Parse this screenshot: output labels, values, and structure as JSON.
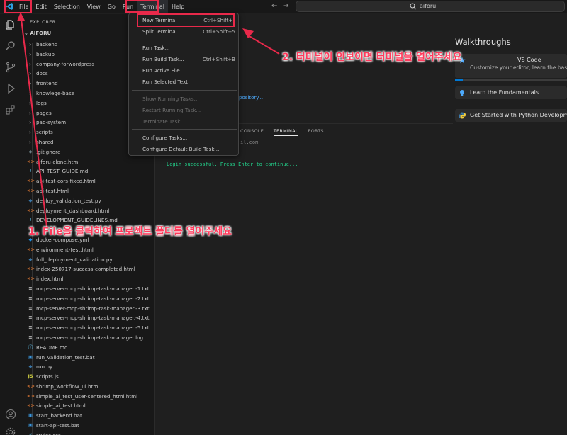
{
  "titlebar": {
    "menus": [
      "File",
      "Edit",
      "Selection",
      "View",
      "Go",
      "Run",
      "Terminal",
      "Help"
    ],
    "active_menu": "Terminal",
    "search_text": "aiforu"
  },
  "sidebar": {
    "title": "EXPLORER",
    "root": "AIFORU",
    "items": [
      {
        "label": "backend",
        "type": "folder"
      },
      {
        "label": "backup",
        "type": "folder"
      },
      {
        "label": "company-forwordpress",
        "type": "folder"
      },
      {
        "label": "docs",
        "type": "folder"
      },
      {
        "label": "frontend",
        "type": "folder"
      },
      {
        "label": "knowlege-base",
        "type": "folder"
      },
      {
        "label": "logs",
        "type": "folder"
      },
      {
        "label": "pages",
        "type": "folder"
      },
      {
        "label": "pad-system",
        "type": "folder"
      },
      {
        "label": "scripts",
        "type": "folder"
      },
      {
        "label": "shared",
        "type": "folder"
      },
      {
        "label": ".gitignore",
        "type": "git"
      },
      {
        "label": "aiforu-clone.html",
        "type": "html"
      },
      {
        "label": "API_TEST_GUIDE.md",
        "type": "md"
      },
      {
        "label": "api-test-cors-fixed.html",
        "type": "html"
      },
      {
        "label": "api-test.html",
        "type": "html"
      },
      {
        "label": "deploy_validation_test.py",
        "type": "py"
      },
      {
        "label": "deployment_dashboard.html",
        "type": "html"
      },
      {
        "label": "DEVELOPMENT_GUIDELINES.md",
        "type": "md"
      },
      {
        "label": "",
        "type": "none"
      },
      {
        "label": "docker-compose.yml",
        "type": "docker"
      },
      {
        "label": "environment-test.html",
        "type": "html"
      },
      {
        "label": "full_deployment_validation.py",
        "type": "py"
      },
      {
        "label": "index-250717-success-completed.html",
        "type": "html"
      },
      {
        "label": "index.html",
        "type": "html"
      },
      {
        "label": "mcp-server-mcp-shrimp-task-manager.-1.txt",
        "type": "txt"
      },
      {
        "label": "mcp-server-mcp-shrimp-task-manager.-2.txt",
        "type": "txt"
      },
      {
        "label": "mcp-server-mcp-shrimp-task-manager.-3.txt",
        "type": "txt"
      },
      {
        "label": "mcp-server-mcp-shrimp-task-manager.-4.txt",
        "type": "txt"
      },
      {
        "label": "mcp-server-mcp-shrimp-task-manager.-5.txt",
        "type": "txt"
      },
      {
        "label": "mcp-server-mcp-shrimp-task-manager.log",
        "type": "txt"
      },
      {
        "label": "README.md",
        "type": "info"
      },
      {
        "label": "run_validation_test.bat",
        "type": "bat"
      },
      {
        "label": "run.py",
        "type": "py"
      },
      {
        "label": "scripts.js",
        "type": "js"
      },
      {
        "label": "shrimp_workflow_ui.html",
        "type": "html"
      },
      {
        "label": "simple_ai_test_user-centered_html.html",
        "type": "html"
      },
      {
        "label": "simple_ai_test.html",
        "type": "html"
      },
      {
        "label": "start_backend.bat",
        "type": "bat"
      },
      {
        "label": "start-api-test.bat",
        "type": "bat"
      },
      {
        "label": "styles.css",
        "type": "css"
      }
    ]
  },
  "terminal_menu": {
    "items": [
      {
        "label": "New Terminal",
        "key": "Ctrl+Shift+`",
        "disabled": false
      },
      {
        "label": "Split Terminal",
        "key": "Ctrl+Shift+5",
        "disabled": false
      },
      {
        "label": "Run Task...",
        "key": "",
        "disabled": false
      },
      {
        "label": "Run Build Task...",
        "key": "Ctrl+Shift+B",
        "disabled": false
      },
      {
        "label": "Run Active File",
        "key": "",
        "disabled": false
      },
      {
        "label": "Run Selected Text",
        "key": "",
        "disabled": false
      },
      {
        "label": "Show Running Tasks...",
        "key": "",
        "disabled": true
      },
      {
        "label": "Restart Running Task...",
        "key": "",
        "disabled": true
      },
      {
        "label": "Terminate Task...",
        "key": "",
        "disabled": true
      },
      {
        "label": "Configure Tasks...",
        "key": "",
        "disabled": false
      },
      {
        "label": "Configure Default Build Task...",
        "key": "",
        "disabled": false
      }
    ]
  },
  "walkthroughs": {
    "title": "Walkthroughs",
    "card1_title": "VS Code",
    "card1_sub": "Customize your editor, learn the basic",
    "card2_title": "Learn the Fundamentals",
    "card3_title": "Get Started with Python Developm",
    "progress": 0.07
  },
  "editor_fragments": {
    "link1": "...",
    "link2": "pository..."
  },
  "panel": {
    "tabs": [
      "CONSOLE",
      "TERMINAL",
      "PORTS"
    ],
    "active_tab": "TERMINAL",
    "term_line1": "il.com",
    "term_line2": "Login successful. Press Enter to continue..."
  },
  "annotations": {
    "step1": "1. File을 클릭하여 프로젝트 폴더를 열어주세요",
    "step2": "2. 터미널이 안보이면 터미널을 열어주세요"
  },
  "colors": {
    "accent": "#0078d4",
    "annotation": "#e8294a",
    "terminal_green": "#23d18b"
  }
}
